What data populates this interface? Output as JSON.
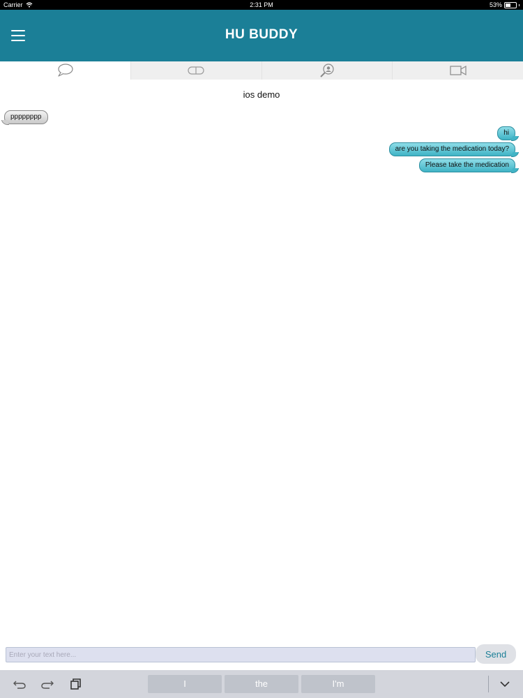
{
  "status_bar": {
    "carrier": "Carrier",
    "time": "2:31 PM",
    "battery_percent_text": "53%",
    "battery_level": 0.53
  },
  "header": {
    "title": "HU BUDDY",
    "background_color": "#1b7f97",
    "menu_icon": "hamburger-menu-icon"
  },
  "tabs": [
    {
      "icon": "chat-bubble-icon",
      "active": true
    },
    {
      "icon": "pill-icon",
      "active": false
    },
    {
      "icon": "search-user-icon",
      "active": false
    },
    {
      "icon": "video-camera-icon",
      "active": false
    }
  ],
  "chat": {
    "title": "ios demo",
    "messages": [
      {
        "direction": "incoming",
        "text": "pppppppp"
      },
      {
        "direction": "outgoing",
        "text": "hi"
      },
      {
        "direction": "outgoing",
        "text": "are you taking the medication today?"
      },
      {
        "direction": "outgoing",
        "text": "Please take the medication"
      }
    ]
  },
  "composer": {
    "placeholder": "Enter your text here...",
    "value": "",
    "send_label": "Send"
  },
  "keyboard": {
    "suggestions": [
      "I",
      "the",
      "I'm"
    ],
    "icons": [
      "undo-icon",
      "redo-icon",
      "paste-icon",
      "chevron-down-icon"
    ]
  }
}
